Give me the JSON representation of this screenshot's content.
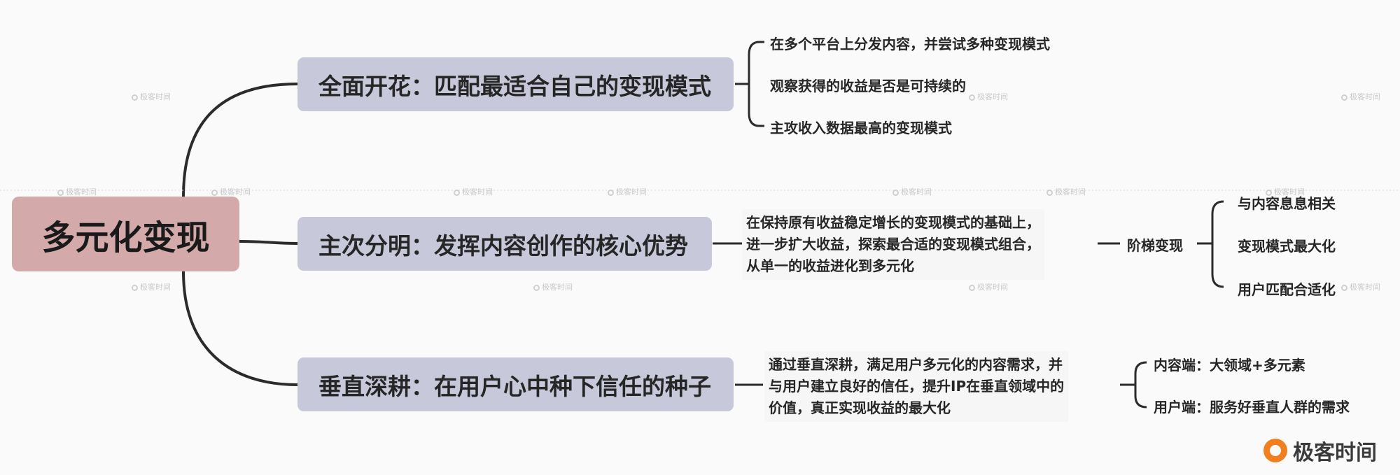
{
  "root": {
    "label": "多元化变现"
  },
  "branches": [
    {
      "label": "全面开花：匹配最适合自己的变现模式",
      "children": [
        "在多个平台上分发内容，并尝试多种变现模式",
        "观察获得的收益是否是可持续的",
        "主攻收入数据最高的变现模式"
      ]
    },
    {
      "label": "主次分明：发挥内容创作的核心优势",
      "detail_lines": [
        "在保持原有收益稳定增长的变现模式的基础上，",
        "进一步扩大收益，探索最合适的变现模式组合，",
        "从单一的收益进化到多元化"
      ],
      "sub_node": "阶梯变现",
      "sub_children": [
        "与内容息息相关",
        "变现模式最大化",
        "用户匹配合适化"
      ]
    },
    {
      "label": "垂直深耕：在用户心中种下信任的种子",
      "detail_lines": [
        "通过垂直深耕，满足用户多元化的内容需求，并",
        "与用户建立良好的信任，提升IP在垂直领域中的",
        "价值，真正实现收益的最大化"
      ],
      "sub_children": [
        "内容端：大领域+多元素",
        "用户端：服务好垂直人群的需求"
      ]
    }
  ],
  "watermark": {
    "text": "极客时间"
  },
  "logo": {
    "text": "极客时间",
    "color": "#f07f1f"
  },
  "colors": {
    "root": "#d4a9aa",
    "branch": "#c7c8da",
    "line": "#2b2b2b"
  }
}
